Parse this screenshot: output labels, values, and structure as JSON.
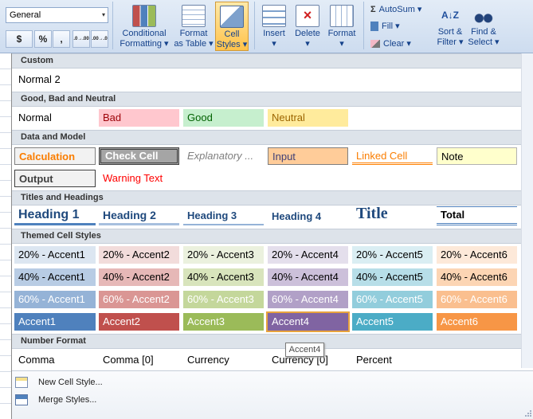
{
  "ribbon": {
    "number_format": "General",
    "currency_btn": "$",
    "percent_btn": "%",
    "comma_btn": ",",
    "inc_decimal_btn": ".0→.00",
    "dec_decimal_btn": ".00→.0",
    "conditional_formatting": [
      "Conditional",
      "Formatting ▾"
    ],
    "format_as_table": [
      "Format",
      "as Table ▾"
    ],
    "cell_styles": [
      "Cell",
      "Styles ▾"
    ],
    "insert": "Insert",
    "delete": "Delete",
    "format": "Format",
    "autosum": "AutoSum ▾",
    "fill": "Fill ▾",
    "clear": "Clear ▾",
    "sort_filter": [
      "Sort &",
      "Filter ▾"
    ],
    "find_select": [
      "Find &",
      "Select ▾"
    ],
    "dropdown_arrow": "▾"
  },
  "sections": {
    "custom": "Custom",
    "good_bad": "Good, Bad and Neutral",
    "data_model": "Data and Model",
    "titles": "Titles and Headings",
    "themed": "Themed Cell Styles",
    "number_format": "Number Format"
  },
  "styles": {
    "custom": [
      "Normal 2"
    ],
    "good_bad": [
      "Normal",
      "Bad",
      "Good",
      "Neutral"
    ],
    "data_row1": [
      "Calculation",
      "Check Cell",
      "Explanatory ...",
      "Input",
      "Linked Cell",
      "Note"
    ],
    "data_row2": [
      "Output",
      "Warning Text"
    ],
    "titles": [
      "Heading 1",
      "Heading 2",
      "Heading 3",
      "Heading 4",
      "Title",
      "Total"
    ],
    "themed_20": [
      "20% - Accent1",
      "20% - Accent2",
      "20% - Accent3",
      "20% - Accent4",
      "20% - Accent5",
      "20% - Accent6"
    ],
    "themed_40": [
      "40% - Accent1",
      "40% - Accent2",
      "40% - Accent3",
      "40% - Accent4",
      "40% - Accent5",
      "40% - Accent6"
    ],
    "themed_60": [
      "60% - Accent1",
      "60% - Accent2",
      "60% - Accent3",
      "60% - Accent4",
      "60% - Accent5",
      "60% - Accent6"
    ],
    "themed_100": [
      "Accent1",
      "Accent2",
      "Accent3",
      "Accent4",
      "Accent5",
      "Accent6"
    ],
    "number_format": [
      "Comma",
      "Comma [0]",
      "Currency",
      "Currency [0]",
      "Percent"
    ]
  },
  "tooltip": "Accent4",
  "menu": {
    "new_cell_style": "New Cell Style...",
    "merge_styles": "Merge Styles..."
  },
  "colors": {
    "accent1": "#4f81bd",
    "accent2": "#c0504d",
    "accent3": "#9bbb59",
    "accent4": "#8064a2",
    "accent5": "#4bacc6",
    "accent6": "#f79646",
    "hover_border": "#e8a33d"
  }
}
